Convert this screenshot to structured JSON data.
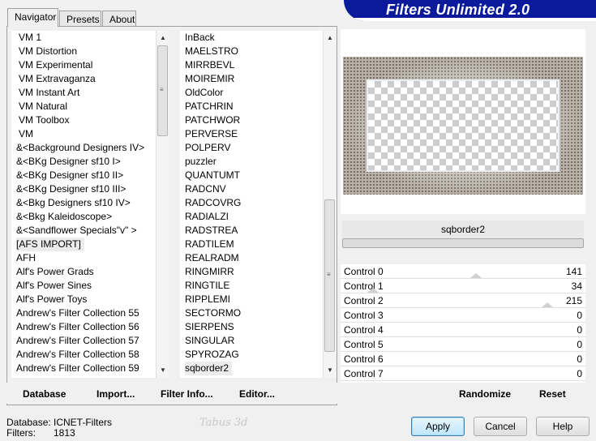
{
  "banner": {
    "title": "Filters Unlimited 2.0"
  },
  "tabs": [
    {
      "label": "Navigator",
      "active": true
    },
    {
      "label": "Presets",
      "active": false
    },
    {
      "label": "About",
      "active": false
    }
  ],
  "categories": {
    "items": [
      "VM 1",
      "VM Distortion",
      "VM Experimental",
      "VM Extravaganza",
      "VM Instant Art",
      "VM Natural",
      "VM Toolbox",
      "VM",
      "&<Background Designers IV>",
      "&<BKg Designer sf10 I>",
      "&<BKg Designer sf10 II>",
      "&<BKg Designer sf10 III>",
      "&<Bkg Designers sf10 IV>",
      "&<Bkg Kaleidoscope>",
      "&<Sandflower Specials\"v\" >",
      "[AFS IMPORT]",
      "AFH",
      "Alf's Power Grads",
      "Alf's Power Sines",
      "Alf's Power Toys",
      "Andrew's Filter Collection 55",
      "Andrew's Filter Collection 56",
      "Andrew's Filter Collection 57",
      "Andrew's Filter Collection 58",
      "Andrew's Filter Collection 59"
    ],
    "selected": "[AFS IMPORT]"
  },
  "filters": {
    "items": [
      "InBack",
      "MAELSTRO",
      "MIRRBEVL",
      "MOIREMIR",
      "OldColor",
      "PATCHRIN",
      "PATCHWOR",
      "PERVERSE",
      "POLPERV",
      "puzzler",
      "QUANTUMT",
      "RADCNV",
      "RADCOVRG",
      "RADIALZI",
      "RADSTREA",
      "RADTILEM",
      "REALRADM",
      "RINGMIRR",
      "RINGTILE",
      "RIPPLEMI",
      "SECTORMO",
      "SIERPENS",
      "SINGULAR",
      "SPYROZAG",
      "sqborder2"
    ],
    "selected": "sqborder2"
  },
  "left_buttons": {
    "database": "Database",
    "import": "Import...",
    "filter_info": "Filter Info...",
    "editor": "Editor..."
  },
  "filter_name": "sqborder2",
  "controls": [
    {
      "label": "Control 0",
      "value": "141",
      "level": 0.553
    },
    {
      "label": "Control 1",
      "value": "34",
      "level": 0.133
    },
    {
      "label": "Control 2",
      "value": "215",
      "level": 0.843
    },
    {
      "label": "Control 3",
      "value": "0",
      "level": 0
    },
    {
      "label": "Control 4",
      "value": "0",
      "level": 0
    },
    {
      "label": "Control 5",
      "value": "0",
      "level": 0
    },
    {
      "label": "Control 6",
      "value": "0",
      "level": 0
    },
    {
      "label": "Control 7",
      "value": "0",
      "level": 0
    }
  ],
  "right_buttons": {
    "randomize": "Randomize",
    "reset": "Reset"
  },
  "status": {
    "database_label": "Database:",
    "database_value": "ICNET-Filters",
    "filters_label": "Filters:",
    "filters_value": "1813"
  },
  "dialog_buttons": {
    "apply": "Apply",
    "cancel": "Cancel",
    "help": "Help"
  },
  "watermark": "Tabus 3d"
}
